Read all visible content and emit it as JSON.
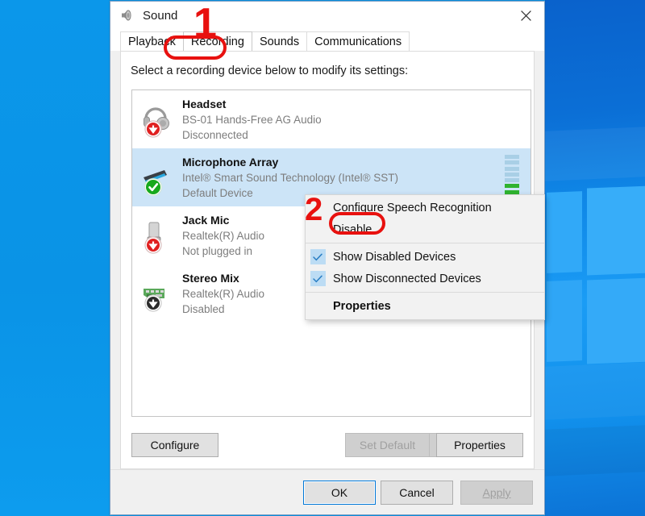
{
  "window": {
    "title": "Sound",
    "title_icon": "speaker-icon",
    "close_label": "Close"
  },
  "tabs": [
    {
      "label": "Playback",
      "active": false
    },
    {
      "label": "Recording",
      "active": true
    },
    {
      "label": "Sounds",
      "active": false
    },
    {
      "label": "Communications",
      "active": false
    }
  ],
  "hint": "Select a recording device below to modify its settings:",
  "devices": [
    {
      "name": "Headset",
      "description": "BS-01 Hands-Free AG Audio",
      "status": "Disconnected",
      "icon": "headset-icon",
      "badge": "red-down-arrow-badge",
      "selected": false
    },
    {
      "name": "Microphone Array",
      "description": "Intel® Smart Sound Technology (Intel® SST)",
      "status": "Default Device",
      "icon": "microphone-array-icon",
      "badge": "green-check-badge",
      "selected": true
    },
    {
      "name": "Jack Mic",
      "description": "Realtek(R) Audio",
      "status": "Not plugged in",
      "icon": "jack-plug-icon",
      "badge": "red-down-arrow-badge",
      "selected": false
    },
    {
      "name": "Stereo Mix",
      "description": "Realtek(R) Audio",
      "status": "Disabled",
      "icon": "sound-card-icon",
      "badge": "black-down-arrow-badge",
      "selected": false
    }
  ],
  "vu_meter": {
    "segments_total": 8,
    "segments_active": 3,
    "color_on": "#2fb32f",
    "color_off": "#a9cfe6"
  },
  "tab_buttons": {
    "configure": "Configure",
    "set_default": "Set Default",
    "set_default_enabled": false,
    "properties": "Properties"
  },
  "footer_buttons": {
    "ok": "OK",
    "cancel": "Cancel",
    "apply": "Apply",
    "apply_enabled": false
  },
  "context_menu": {
    "items": [
      {
        "label": "Configure Speech Recognition",
        "checked": false,
        "bold": false
      },
      {
        "label": "Disable",
        "checked": false,
        "bold": false
      },
      {
        "label": "Show Disabled Devices",
        "checked": true,
        "bold": false
      },
      {
        "label": "Show Disconnected Devices",
        "checked": true,
        "bold": false
      },
      {
        "label": "Properties",
        "checked": false,
        "bold": true
      }
    ]
  },
  "annotations": [
    {
      "number": "1",
      "target": "Recording tab"
    },
    {
      "number": "2",
      "target": "Disable menu item"
    }
  ],
  "colors": {
    "annotation_red": "#e8110f",
    "selection_blue": "#cce4f7",
    "accent_blue": "#0078d7",
    "desktop_blue": "#0a96e8"
  }
}
